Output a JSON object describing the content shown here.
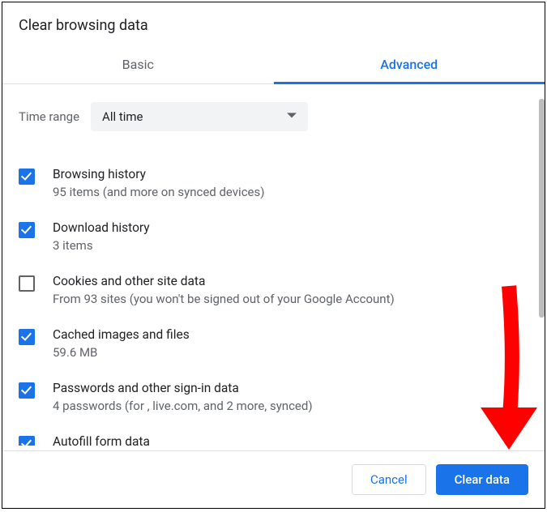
{
  "title": "Clear browsing data",
  "tabs": {
    "basic": "Basic",
    "advanced": "Advanced",
    "active": "advanced"
  },
  "time_range": {
    "label": "Time range",
    "value": "All time"
  },
  "items": [
    {
      "checked": true,
      "title": "Browsing history",
      "subtitle": "95 items (and more on synced devices)"
    },
    {
      "checked": true,
      "title": "Download history",
      "subtitle": "3 items"
    },
    {
      "checked": false,
      "title": "Cookies and other site data",
      "subtitle": "From 93 sites (you won't be signed out of your Google Account)"
    },
    {
      "checked": true,
      "title": "Cached images and files",
      "subtitle": "59.6 MB"
    },
    {
      "checked": true,
      "title": "Passwords and other sign-in data",
      "subtitle": "4 passwords (for , live.com, and 2 more, synced)"
    },
    {
      "checked": true,
      "title": "Autofill form data",
      "subtitle": ""
    }
  ],
  "buttons": {
    "cancel": "Cancel",
    "confirm": "Clear data"
  },
  "annotation": {
    "arrow_color": "#ff0000"
  }
}
